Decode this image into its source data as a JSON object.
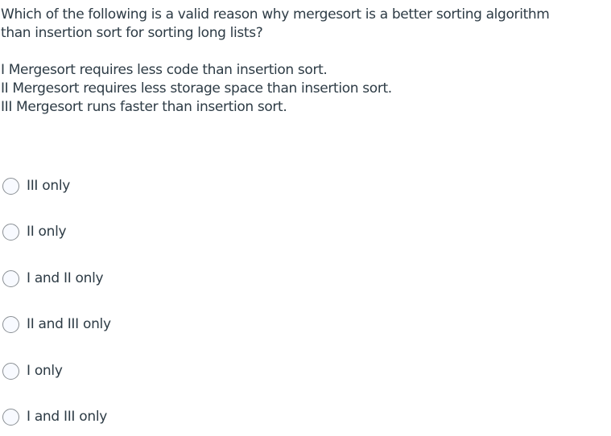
{
  "question": {
    "line1": "Which of the following is a valid reason why mergesort is a better sorting algorithm",
    "line2": "than insertion sort for sorting long  lists?"
  },
  "statements": [
    "I Mergesort requires less code than insertion sort.",
    "II Mergesort requires less storage space than insertion sort.",
    "III Mergesort runs faster than insertion sort."
  ],
  "answers": [
    {
      "label": "III only",
      "selected": false
    },
    {
      "label": "II only",
      "selected": false
    },
    {
      "label": "I and II only",
      "selected": false
    },
    {
      "label": "II and III only",
      "selected": false
    },
    {
      "label": "I only",
      "selected": false
    },
    {
      "label": "I and III only",
      "selected": false
    }
  ]
}
